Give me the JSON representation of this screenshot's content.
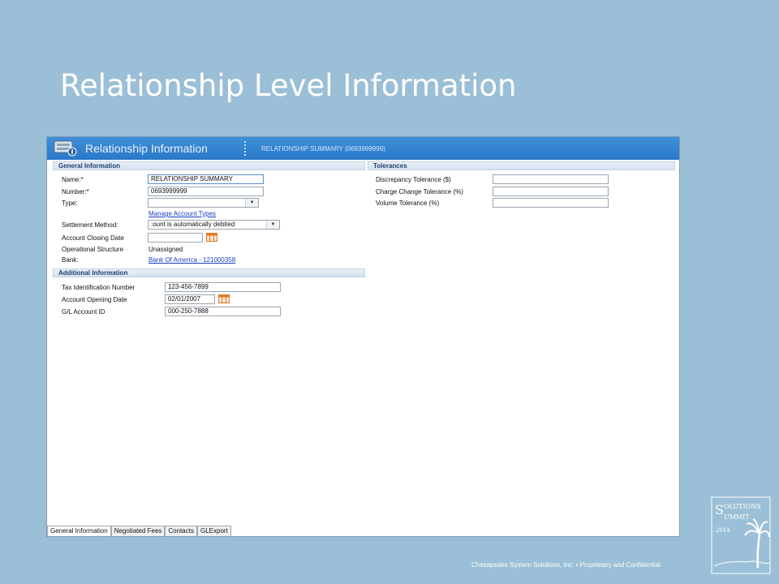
{
  "slide": {
    "title": "Relationship Level Information"
  },
  "window": {
    "title": "Relationship Information",
    "subtitle": "RELATIONSHIP SUMMARY (0693999999)"
  },
  "general": {
    "heading": "General Information",
    "name_label": "Name:*",
    "name_value": "RELATIONSHIP SUMMARY",
    "number_label": "Number:*",
    "number_value": "0693999999",
    "type_label": "Type:",
    "type_value": "",
    "manage_link": "Manage Account Types",
    "settlement_label": "Settlement Method:",
    "settlement_value": ":ount is automatically debited",
    "closing_label": "Account Closing Date",
    "closing_value": "",
    "opstruct_label": "Operational Structure",
    "opstruct_value": "Unassigned",
    "bank_label": "Bank:",
    "bank_value": "Bank Of America - 121000358"
  },
  "additional": {
    "heading": "Additional Information",
    "tax_label": "Tax Identification Number",
    "tax_value": "123-456-7899",
    "opening_label": "Account Opening Date",
    "opening_value": "02/01/2007",
    "gl_label": "G/L Account ID",
    "gl_value": "000-250-7888"
  },
  "tolerances": {
    "heading": "Tolerances",
    "discrepancy_label": "Discrepancy Tolerance ($)",
    "charge_label": "Charge Change Tolerance (%)",
    "volume_label": "Volume Tolerance (%)"
  },
  "tabs": [
    "General Information",
    "Negotiated Fees",
    "Contacts",
    "GLExport"
  ],
  "footer": "Chesapeake System Solutions, Inc.  ▪  Proprietary and Confidential",
  "colors": {
    "background": "#9bbfd6",
    "header": "#2a78c8",
    "link": "#1a3fbf"
  },
  "icons": {
    "header": "server-card-icon",
    "calendar": "calendar-icon",
    "logo": "palm-tree-logo"
  }
}
